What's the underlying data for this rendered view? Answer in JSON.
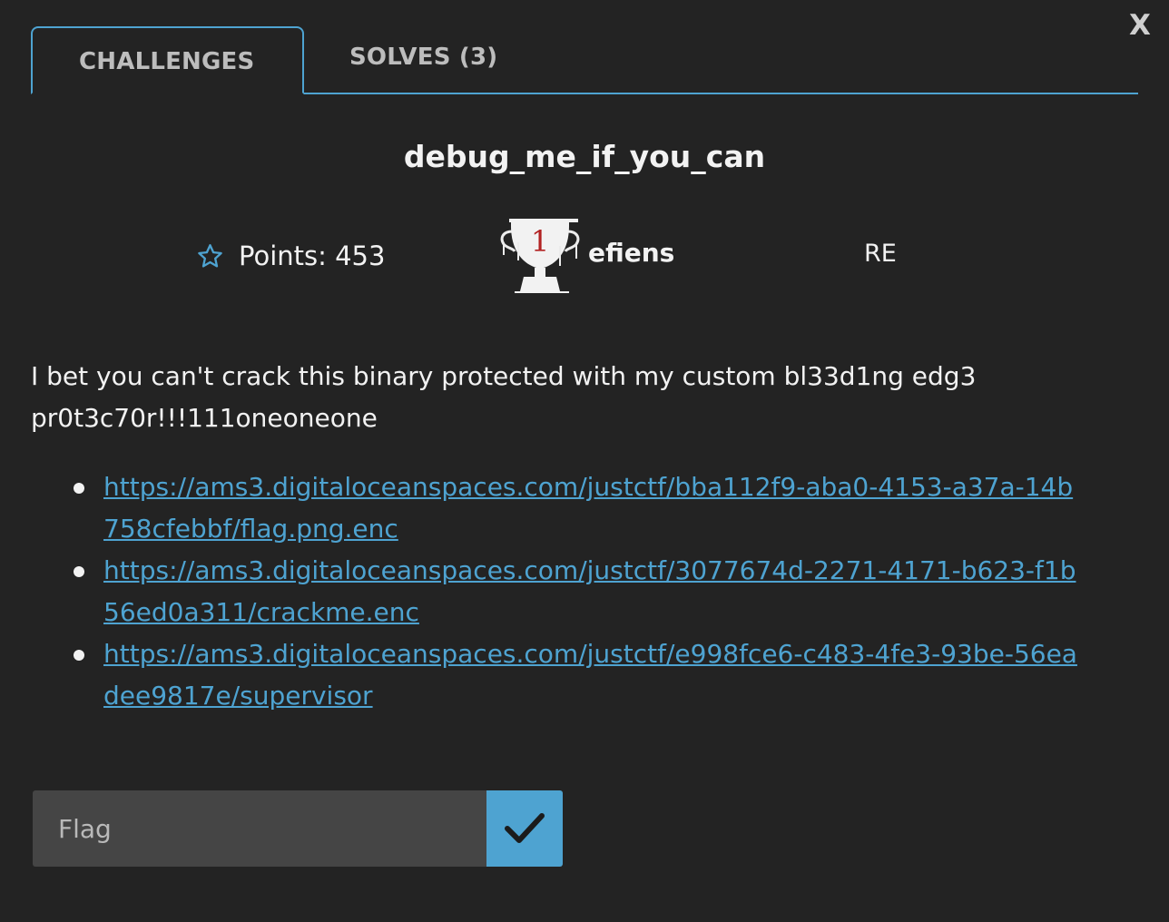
{
  "modal": {
    "close_label": "X"
  },
  "tabs": [
    {
      "label": "CHALLENGES",
      "active": true
    },
    {
      "label": "SOLVES (3)",
      "active": false
    }
  ],
  "challenge": {
    "name": "debug_me_if_you_can",
    "points_text": "Points: 453",
    "first_blood_rank": "1",
    "first_blood_user": "efiens",
    "category": "RE",
    "description": "I bet you can't crack this binary protected with my custom bl33d1ng edg3 pr0t3c70r!!!111oneoneone",
    "files": [
      "https://ams3.digitaloceanspaces.com/justctf/bba112f9-aba0-4153-a37a-14b758cfebbf/flag.png.enc",
      "https://ams3.digitaloceanspaces.com/justctf/3077674d-2271-4171-b623-f1b56ed0a311/crackme.enc",
      "https://ams3.digitaloceanspaces.com/justctf/e998fce6-c483-4fe3-93be-56eadee9817e/supervisor"
    ]
  },
  "flag_form": {
    "placeholder": "Flag",
    "value": ""
  },
  "icons": {
    "star": "star-outline-icon",
    "trophy": "trophy-icon",
    "submit": "checkmark-icon",
    "close": "close-icon"
  },
  "colors": {
    "background": "#232323",
    "accent": "#4ea3d1",
    "input_bg": "#454545",
    "text": "#f2f2f2",
    "trophy_rank": "#b22222"
  }
}
